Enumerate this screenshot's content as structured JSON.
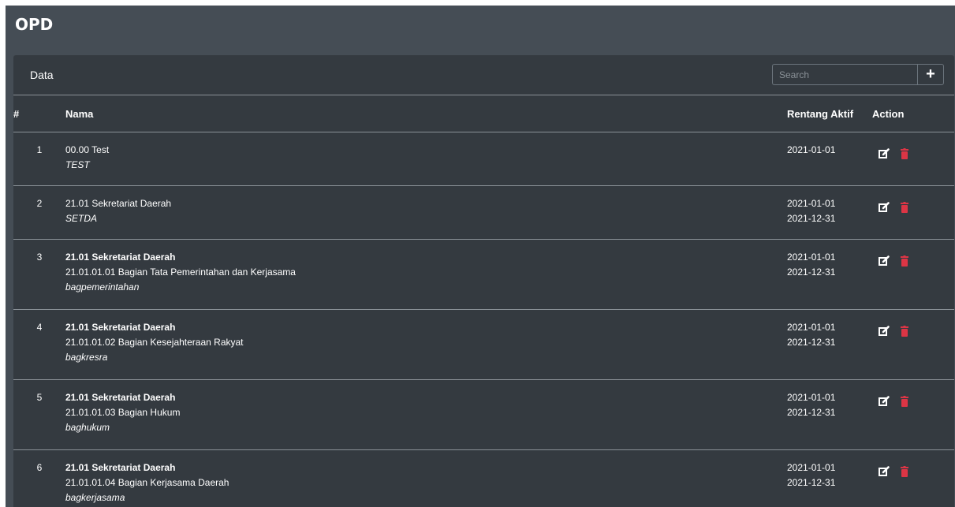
{
  "page": {
    "title": "OPD"
  },
  "card": {
    "title": "Data",
    "search": {
      "placeholder": "Search",
      "value": ""
    },
    "add_label": "+"
  },
  "table": {
    "headers": {
      "no": "#",
      "nama": "Nama",
      "rentang": "Rentang Aktif",
      "action": "Action"
    },
    "rows": [
      {
        "no": "1",
        "line1": "00.00 Test",
        "line2": "TEST",
        "line3": "",
        "start": "2021-01-01",
        "end": ""
      },
      {
        "no": "2",
        "line1": "21.01 Sekretariat Daerah",
        "line2": "SETDA",
        "line3": "",
        "start": "2021-01-01",
        "end": "2021-12-31"
      },
      {
        "no": "3",
        "line1": "21.01 Sekretariat Daerah",
        "line2": "21.01.01.01 Bagian Tata Pemerintahan dan Kerjasama",
        "line3": "bagpemerintahan",
        "start": "2021-01-01",
        "end": "2021-12-31"
      },
      {
        "no": "4",
        "line1": "21.01 Sekretariat Daerah",
        "line2": "21.01.01.02 Bagian Kesejahteraan Rakyat",
        "line3": "bagkresra",
        "start": "2021-01-01",
        "end": "2021-12-31"
      },
      {
        "no": "5",
        "line1": "21.01 Sekretariat Daerah",
        "line2": "21.01.01.03 Bagian Hukum",
        "line3": "baghukum",
        "start": "2021-01-01",
        "end": "2021-12-31"
      },
      {
        "no": "6",
        "line1": "21.01 Sekretariat Daerah",
        "line2": "21.01.01.04 Bagian Kerjasama Daerah",
        "line3": "bagkerjasama",
        "start": "2021-01-01",
        "end": "2021-12-31"
      }
    ]
  },
  "icons": {
    "edit": "edit-icon",
    "delete": "trash-icon"
  },
  "colors": {
    "page_bg": "#454d55",
    "card_bg": "#343a40",
    "delete": "#dc3545",
    "text": "#ffffff"
  }
}
